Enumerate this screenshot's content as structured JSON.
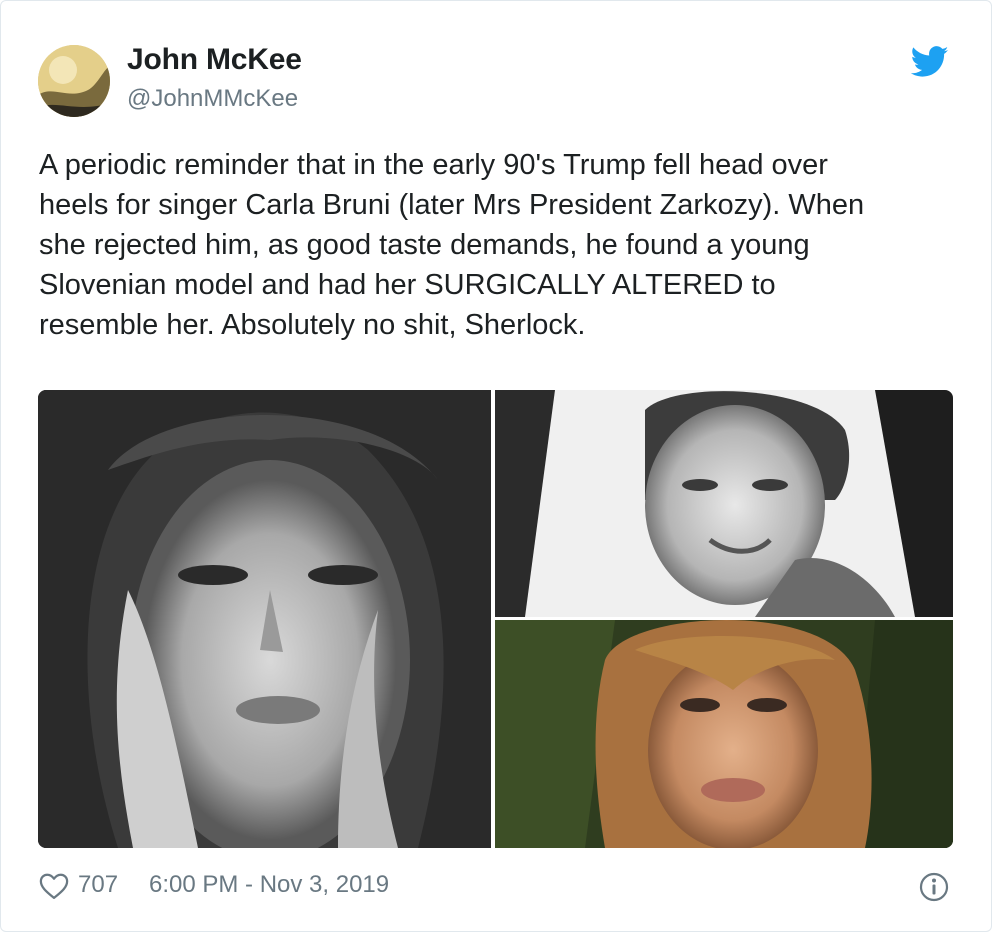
{
  "author": {
    "name": "John McKee",
    "handle": "@JohnMMcKee"
  },
  "tweet": {
    "text": "A periodic reminder that in the early 90's Trump fell head over\nheels for singer Carla Bruni (later Mrs President Zarkozy). When\nshe rejected him, as good taste demands, he found a young\nSlovenian model and had her SURGICALLY ALTERED to\nresemble her. Absolutely no shit, Sherlock."
  },
  "media": [
    {
      "kind": "photo",
      "tone": "black-and-white portrait"
    },
    {
      "kind": "photo",
      "tone": "black-and-white portrait"
    },
    {
      "kind": "photo",
      "tone": "color portrait"
    }
  ],
  "footer": {
    "like_count": "707",
    "timestamp": "6:00 PM - Nov 3, 2019"
  },
  "icons": {
    "brand": "twitter-bird-icon",
    "like": "heart-icon",
    "info": "info-icon"
  },
  "colors": {
    "brand_blue": "#1da1f2",
    "text_primary": "#1c2022",
    "text_secondary": "#697882",
    "border": "#e1e8ed"
  }
}
